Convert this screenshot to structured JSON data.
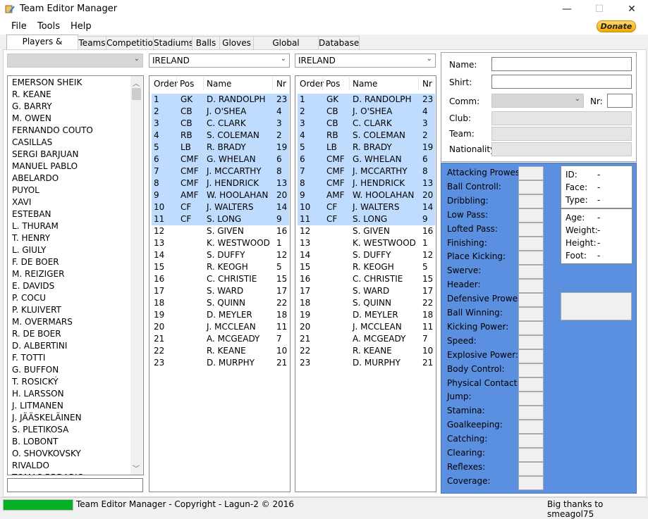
{
  "window": {
    "title": "Team Editor Manager",
    "minimize": "—",
    "maximize": "☐",
    "close": "✕"
  },
  "menu": [
    "File",
    "Tools",
    "Help"
  ],
  "donate_label": "Donate",
  "tabs": [
    "Players & Transfers",
    "Teams",
    "Competition",
    "Stadiums",
    "Balls",
    "Gloves",
    "Global Functions",
    "Database"
  ],
  "left_combo_value": "",
  "team_combo_left": "IRELAND",
  "team_combo_right": "IRELAND",
  "player_list": [
    "EMERSON SHEIK",
    "R. KEANE",
    "G. BARRY",
    "M. OWEN",
    "FERNANDO COUTO",
    "CASILLAS",
    "SERGI BARJUAN",
    "MANUEL PABLO",
    "ABELARDO",
    "PUYOL",
    "XAVI",
    "ESTEBAN",
    "L. THURAM",
    "T. HENRY",
    "L. GIULY",
    "F. DE BOER",
    "M. REIZIGER",
    "E. DAVIDS",
    "P. COCU",
    "P. KLUIVERT",
    "M. OVERMARS",
    "R. DE BOER",
    "D. ALBERTINI",
    "F. TOTTI",
    "G. BUFFON",
    "T. ROSICKÝ",
    "H. LARSSON",
    "J. LITMANEN",
    "J. JÄÄSKELÄINEN",
    "S. PLETIKOSA",
    "B. LOBONT",
    "O. SHOVKOVSKY",
    "RIVALDO",
    "TOMAS BRDARIC"
  ],
  "search_value": "",
  "grid_headers": {
    "order": "Order",
    "pos": "Pos",
    "name": "Name",
    "nr": "Nr"
  },
  "squad_rows": [
    {
      "order": "1",
      "pos": "GK",
      "name": "D. RANDOLPH",
      "nr": "23"
    },
    {
      "order": "2",
      "pos": "CB",
      "name": "J. O'SHEA",
      "nr": "4"
    },
    {
      "order": "3",
      "pos": "CB",
      "name": "C. CLARK",
      "nr": "3"
    },
    {
      "order": "4",
      "pos": "RB",
      "name": "S. COLEMAN",
      "nr": "2"
    },
    {
      "order": "5",
      "pos": "LB",
      "name": "R. BRADY",
      "nr": "19"
    },
    {
      "order": "6",
      "pos": "CMF",
      "name": "G. WHELAN",
      "nr": "6"
    },
    {
      "order": "7",
      "pos": "CMF",
      "name": "J. MCCARTHY",
      "nr": "8"
    },
    {
      "order": "8",
      "pos": "CMF",
      "name": "J. HENDRICK",
      "nr": "13"
    },
    {
      "order": "9",
      "pos": "AMF",
      "name": "W. HOOLAHAN",
      "nr": "20"
    },
    {
      "order": "10",
      "pos": "CF",
      "name": "J. WALTERS",
      "nr": "14"
    },
    {
      "order": "11",
      "pos": "CF",
      "name": "S. LONG",
      "nr": "9"
    },
    {
      "order": "12",
      "pos": "",
      "name": "S. GIVEN",
      "nr": "16"
    },
    {
      "order": "13",
      "pos": "",
      "name": "K. WESTWOOD",
      "nr": "1"
    },
    {
      "order": "14",
      "pos": "",
      "name": "S. DUFFY",
      "nr": "12"
    },
    {
      "order": "15",
      "pos": "",
      "name": "R. KEOGH",
      "nr": "5"
    },
    {
      "order": "16",
      "pos": "",
      "name": "C. CHRISTIE",
      "nr": "15"
    },
    {
      "order": "17",
      "pos": "",
      "name": "S. WARD",
      "nr": "17"
    },
    {
      "order": "18",
      "pos": "",
      "name": "S. QUINN",
      "nr": "22"
    },
    {
      "order": "19",
      "pos": "",
      "name": "D. MEYLER",
      "nr": "18"
    },
    {
      "order": "20",
      "pos": "",
      "name": "J. MCCLEAN",
      "nr": "11"
    },
    {
      "order": "21",
      "pos": "",
      "name": "A. MCGEADY",
      "nr": "7"
    },
    {
      "order": "22",
      "pos": "",
      "name": "R. KEANE",
      "nr": "10"
    },
    {
      "order": "23",
      "pos": "",
      "name": "D. MURPHY",
      "nr": "21"
    }
  ],
  "selected_rows": 11,
  "info": {
    "name_label": "Name:",
    "shirt_label": "Shirt:",
    "comm_label": "Comm:",
    "nr_label": "Nr:",
    "club_label": "Club:",
    "team_label": "Team:",
    "nationality_label": "Nationality:"
  },
  "stats": [
    "Attacking Prowess:",
    "Ball Controll:",
    "Dribbling:",
    "Low Pass:",
    "Lofted Pass:",
    "Finishing:",
    "Place Kicking:",
    "Swerve:",
    "Header:",
    "Defensive Prowess:",
    "Ball Winning:",
    "Kicking Power:",
    "Speed:",
    "Explosive Power:",
    "Body Control:",
    "Physical Contact:",
    "Jump:",
    "Stamina:",
    "Goalkeeping:",
    "Catching:",
    "Clearing:",
    "Reflexes:",
    "Coverage:"
  ],
  "card1": [
    {
      "label": "ID:",
      "value": "-"
    },
    {
      "label": "Face:",
      "value": "-"
    },
    {
      "label": "Type:",
      "value": "-"
    }
  ],
  "card2": [
    {
      "label": "Age:",
      "value": "-"
    },
    {
      "label": "Weight:",
      "value": "-"
    },
    {
      "label": "Height:",
      "value": "-"
    },
    {
      "label": "Foot:",
      "value": "-"
    }
  ],
  "status": {
    "progress": 1.0,
    "copyright": "Team Editor Manager - Copyright - Lagun-2 © 2016",
    "thanks": "Big thanks to smeagol75"
  },
  "colors": {
    "accent_stats": "#5b8fe0",
    "selection": "#bfdcff",
    "progress": "#06b025"
  }
}
